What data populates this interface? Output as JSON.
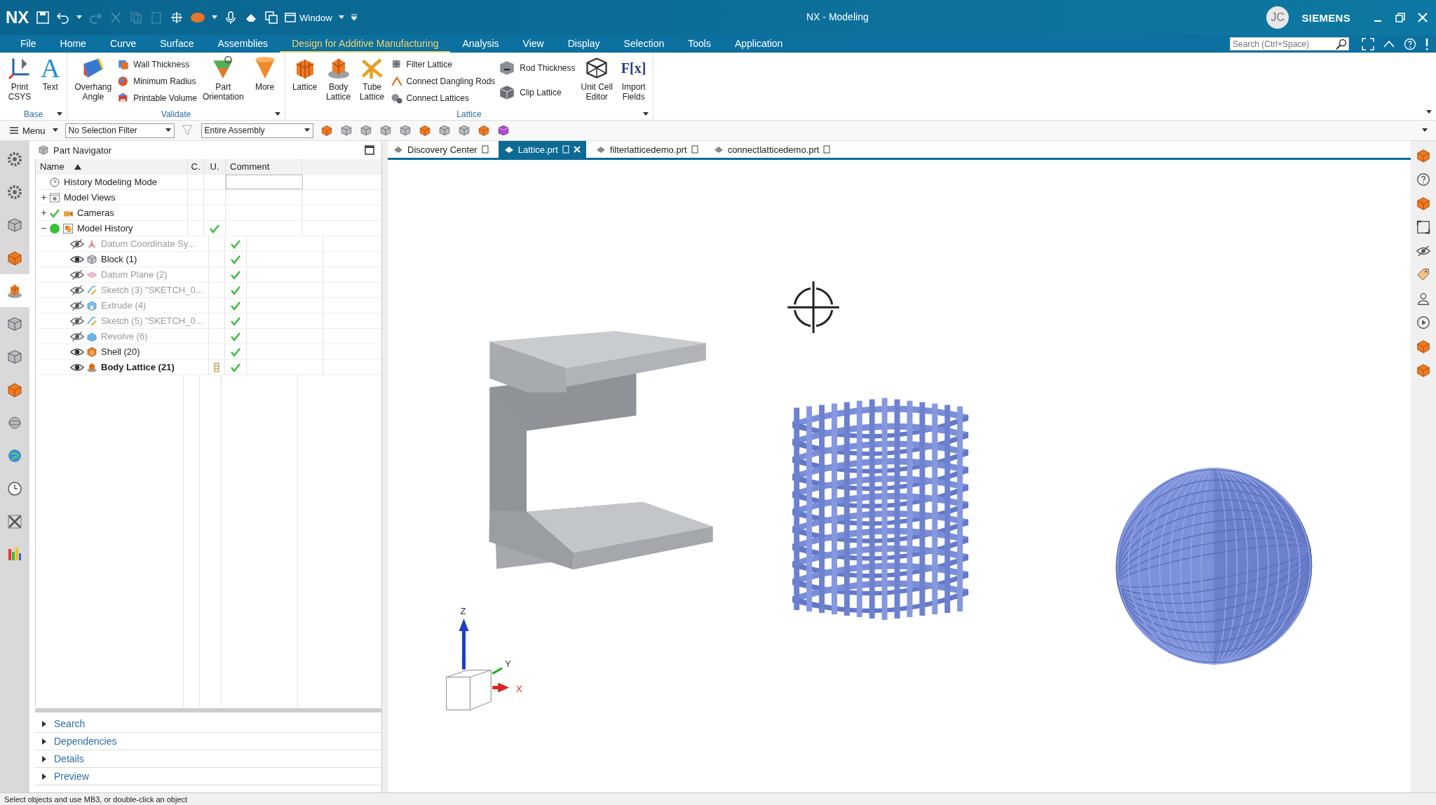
{
  "window": {
    "logo": "NX",
    "title": "NX - Modeling",
    "quick_menu": "Window",
    "user_initials": "JC",
    "brand": "SIEMENS"
  },
  "menu": {
    "tabs": [
      {
        "label": "File",
        "selected": false
      },
      {
        "label": "Home",
        "selected": false
      },
      {
        "label": "Curve",
        "selected": false
      },
      {
        "label": "Surface",
        "selected": false
      },
      {
        "label": "Assemblies",
        "selected": false
      },
      {
        "label": "Design for Additive Manufacturing",
        "selected": true
      },
      {
        "label": "Analysis",
        "selected": false
      },
      {
        "label": "View",
        "selected": false
      },
      {
        "label": "Display",
        "selected": false
      },
      {
        "label": "Selection",
        "selected": false
      },
      {
        "label": "Tools",
        "selected": false
      },
      {
        "label": "Application",
        "selected": false
      }
    ],
    "search_placeholder": "Search (Ctrl+Space)"
  },
  "ribbon": [
    {
      "label": "Base",
      "items": [
        {
          "kind": "large",
          "label": "Print\nCSYS"
        },
        {
          "kind": "large",
          "glyph": "A",
          "label": "Text"
        }
      ]
    },
    {
      "label": "Validate",
      "items": [
        {
          "kind": "large",
          "label": "Overhang\nAngle"
        },
        {
          "kind": "stack",
          "items": [
            {
              "label": "Wall Thickness"
            },
            {
              "label": "Minimum Radius"
            },
            {
              "label": "Printable Volume"
            }
          ]
        },
        {
          "kind": "large",
          "label": "Part\nOrientation"
        },
        {
          "kind": "large",
          "label": "More"
        }
      ]
    },
    {
      "label": "Lattice",
      "items": [
        {
          "kind": "large",
          "label": "Lattice"
        },
        {
          "kind": "large",
          "label": "Body\nLattice"
        },
        {
          "kind": "large",
          "label": "Tube\nLattice"
        },
        {
          "kind": "stack",
          "items": [
            {
              "label": "Filter Lattice"
            },
            {
              "label": "Connect Dangling Rods"
            },
            {
              "label": "Connect Lattices"
            }
          ]
        },
        {
          "kind": "stack",
          "items": [
            {
              "label": "Rod Thickness"
            },
            {
              "label": "Clip Lattice"
            }
          ]
        },
        {
          "kind": "large",
          "label": "Unit Cell\nEditor"
        },
        {
          "kind": "large",
          "glyph": "F[x]",
          "label": "Import\nFields"
        }
      ]
    }
  ],
  "toolbar": {
    "menu": "Menu",
    "selection_filter": "No Selection Filter",
    "scope": "Entire Assembly"
  },
  "navigator": {
    "title": "Part Navigator",
    "columns": [
      "Name",
      "C.",
      "U.",
      "Comment"
    ],
    "tree": [
      {
        "label": "History Modeling Mode"
      },
      {
        "label": "Model Views",
        "expanded": false
      },
      {
        "label": "Cameras",
        "expanded": false,
        "checked": true
      },
      {
        "label": "Model History",
        "expanded": true,
        "active": true,
        "uptodate": true,
        "children": [
          {
            "label": "Datum Coordinate Sy...",
            "visible": false,
            "current": false,
            "uptodate": true
          },
          {
            "label": "Block (1)",
            "visible": true,
            "current": false,
            "uptodate": true
          },
          {
            "label": "Datum Plane (2)",
            "visible": false,
            "current": false,
            "uptodate": true
          },
          {
            "label": "Sketch (3) \"SKETCH_0...",
            "visible": false,
            "current": false,
            "uptodate": true
          },
          {
            "label": "Extrude (4)",
            "visible": false,
            "current": false,
            "uptodate": true
          },
          {
            "label": "Sketch (5) \"SKETCH_0...",
            "visible": false,
            "current": false,
            "uptodate": true
          },
          {
            "label": "Revolve (6)",
            "visible": false,
            "current": false,
            "uptodate": true
          },
          {
            "label": "Shell (20)",
            "visible": true,
            "current": false,
            "uptodate": true
          },
          {
            "label": "Body Lattice (21)",
            "visible": true,
            "current": true,
            "uptodate": true,
            "pinned": true
          }
        ]
      }
    ],
    "panels": [
      "Search",
      "Dependencies",
      "Details",
      "Preview"
    ]
  },
  "doc_tabs": [
    {
      "label": "Discovery Center",
      "selected": false
    },
    {
      "label": "Lattice.prt",
      "selected": true
    },
    {
      "label": "filterlatticedemo.prt",
      "selected": false
    },
    {
      "label": "connectlatticedemo.prt",
      "selected": false
    }
  ],
  "triad": {
    "z": "Z",
    "y": "Y",
    "x": "X"
  },
  "status_bar": "Select objects and use MB3, or double-click an object"
}
